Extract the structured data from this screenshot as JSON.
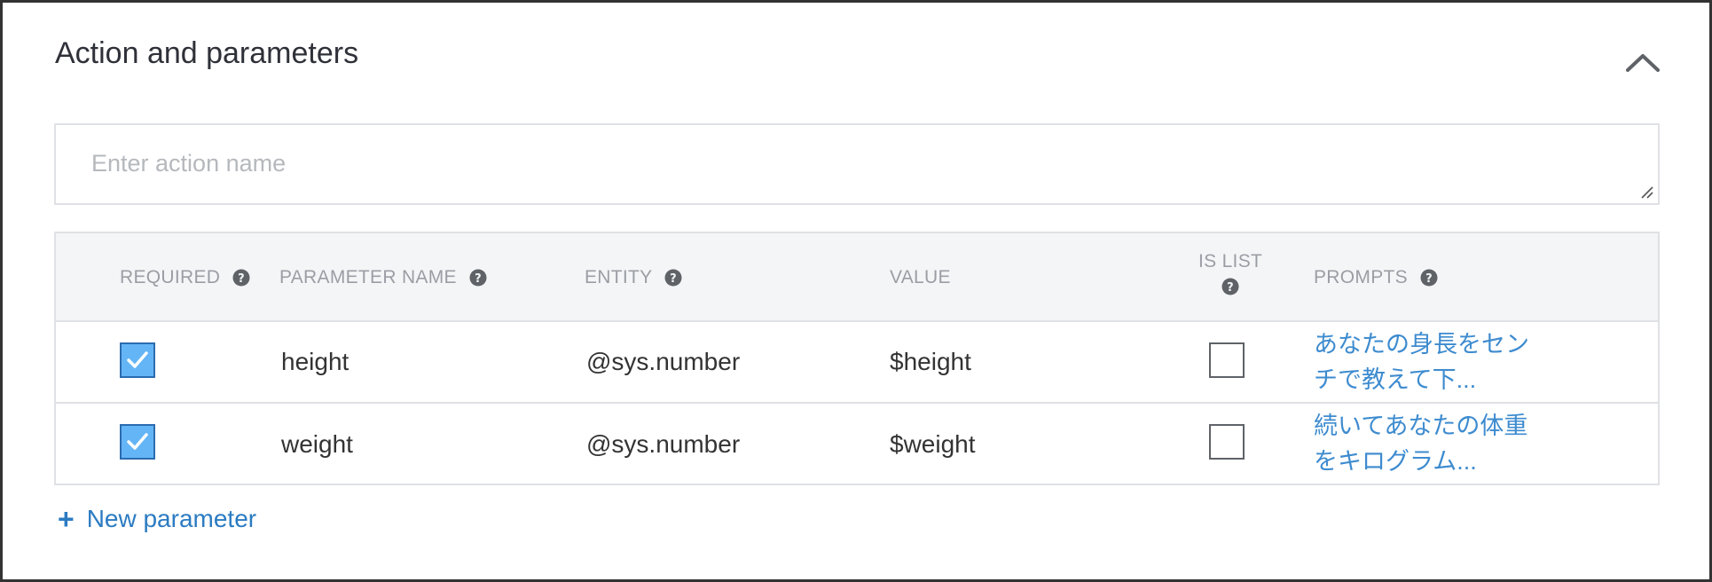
{
  "section": {
    "title": "Action and parameters",
    "collapse_icon": "chevron-up-icon"
  },
  "action": {
    "placeholder": "Enter action name",
    "value": ""
  },
  "table": {
    "headers": {
      "required": "REQUIRED",
      "parameter_name": "PARAMETER NAME",
      "entity": "ENTITY",
      "value": "VALUE",
      "is_list_line1": "IS LIST",
      "prompts": "PROMPTS"
    },
    "help_icon": "question-circle-icon",
    "rows": [
      {
        "required": true,
        "name": "height",
        "entity": "@sys.number",
        "value": "$height",
        "is_list": false,
        "prompt_line1": "あなたの身長をセン",
        "prompt_line2": "チで教えて下..."
      },
      {
        "required": true,
        "name": "weight",
        "entity": "@sys.number",
        "value": "$weight",
        "is_list": false,
        "prompt_line1": "続いてあなたの体重",
        "prompt_line2": "をキログラム..."
      }
    ]
  },
  "new_parameter": {
    "icon": "+",
    "label": "New parameter"
  },
  "colors": {
    "link": "#2b7bc2",
    "checkbox_fill": "#64b5f6",
    "header_bg": "#f4f5f7"
  }
}
